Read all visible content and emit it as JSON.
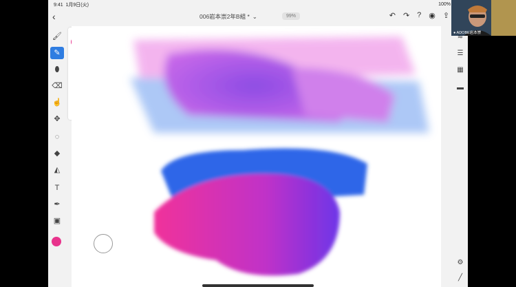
{
  "status": {
    "time": "9:41",
    "date": "1月9日(火)",
    "battery": "100%"
  },
  "document": {
    "title": "006岩本崇2年B組 *",
    "zoom": "99%"
  },
  "brush": {
    "size": "424"
  },
  "colors": {
    "primary": "#e8338c",
    "accent": "#2f7de1"
  },
  "webcam": {
    "label": "● ADOBE岩本崇"
  },
  "left_tools": [
    {
      "name": "paint-brush-icon",
      "glyph": "🖌"
    },
    {
      "name": "pixel-brush-icon",
      "glyph": "✎"
    },
    {
      "name": "mixer-brush-icon",
      "glyph": "⬮"
    },
    {
      "name": "eraser-icon",
      "glyph": "⌫"
    },
    {
      "name": "smudge-icon",
      "glyph": "☝"
    },
    {
      "name": "transform-icon",
      "glyph": "✥"
    },
    {
      "name": "lasso-icon",
      "glyph": "◌"
    },
    {
      "name": "fill-icon",
      "glyph": "◆"
    },
    {
      "name": "shape-icon",
      "glyph": "◭"
    },
    {
      "name": "text-icon",
      "glyph": "T"
    },
    {
      "name": "eyedropper-icon",
      "glyph": "✒"
    },
    {
      "name": "image-icon",
      "glyph": "▣"
    }
  ],
  "top_actions": [
    {
      "name": "undo-icon",
      "glyph": "↶"
    },
    {
      "name": "redo-icon",
      "glyph": "↷"
    },
    {
      "name": "help-icon",
      "glyph": "?"
    },
    {
      "name": "user-icon",
      "glyph": "◉"
    },
    {
      "name": "share-icon",
      "glyph": "⇪"
    },
    {
      "name": "settings-icon",
      "glyph": "⚙"
    }
  ],
  "right_tools": [
    {
      "name": "layers-icon",
      "glyph": "≋"
    },
    {
      "name": "adjustments-icon",
      "glyph": "☰"
    },
    {
      "name": "grid-icon",
      "glyph": "▦"
    },
    {
      "name": "comment-icon",
      "glyph": "▬"
    }
  ]
}
